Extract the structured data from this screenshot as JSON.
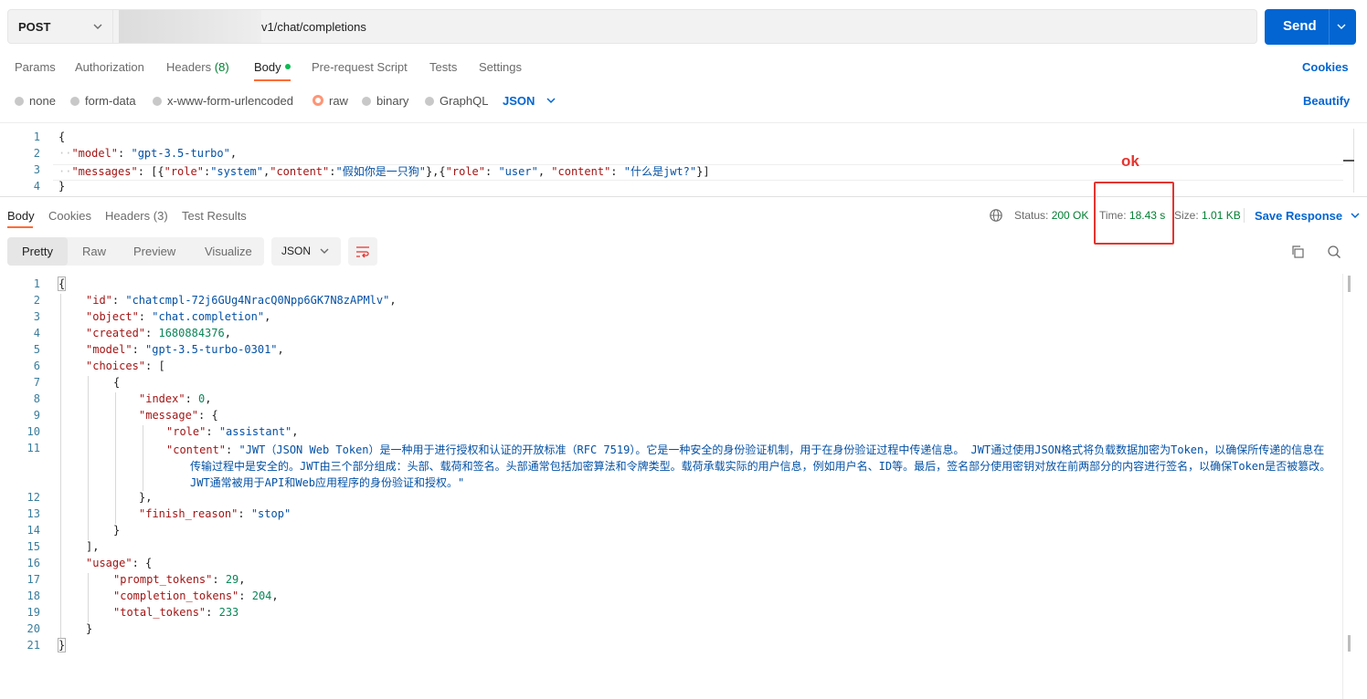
{
  "request": {
    "method": "POST",
    "url_visible": "v1/chat/completions",
    "send_label": "Send"
  },
  "request_tabs": [
    {
      "label": "Params"
    },
    {
      "label": "Authorization"
    },
    {
      "label": "Headers",
      "count": "(8)"
    },
    {
      "label": "Body",
      "active": true
    },
    {
      "label": "Pre-request Script"
    },
    {
      "label": "Tests"
    },
    {
      "label": "Settings"
    }
  ],
  "cookies_link": "Cookies",
  "body_types": [
    "none",
    "form-data",
    "x-www-form-urlencoded",
    "raw",
    "binary",
    "GraphQL"
  ],
  "body_type_selected": "raw",
  "body_format": "JSON",
  "beautify_label": "Beautify",
  "request_body": {
    "line_numbers": [
      "1",
      "2",
      "3",
      "4"
    ],
    "model_key": "\"model\"",
    "model_val": "\"gpt-3.5-turbo\"",
    "messages_key": "\"messages\"",
    "system_role": "\"system\"",
    "system_content": "\"假如你是一只狗\"",
    "user_role": "\"user\"",
    "user_content": "\"什么是jwt?\""
  },
  "response_tabs": [
    {
      "label": "Body",
      "active": true
    },
    {
      "label": "Cookies"
    },
    {
      "label": "Headers",
      "count": "(3)"
    },
    {
      "label": "Test Results"
    }
  ],
  "response_meta": {
    "status_label": "Status:",
    "status_value": "200 OK",
    "time_label": "Time:",
    "time_value": "18.43 s",
    "size_label": "Size:",
    "size_value": "1.01 KB",
    "save_response": "Save Response"
  },
  "view_modes": [
    "Pretty",
    "Raw",
    "Preview",
    "Visualize"
  ],
  "response_format": "JSON",
  "annotation": "ok",
  "response_body": {
    "id": "\"chatcmpl-72j6GUg4NracQ0Npp6GK7N8zAPMlv\"",
    "object": "\"chat.completion\"",
    "created": "1680884376",
    "model": "\"gpt-3.5-turbo-0301\"",
    "index": "0",
    "role": "\"assistant\"",
    "content_line1": "\"JWT（JSON Web Token）是一种用于进行授权和认证的开放标准（RFC 7519）。它是一种安全的身份验证机制，用于在身份验证过程中传递信息。 JWT通过使用JSON格式将负载数据加密为Token，以确保所传递的信息在",
    "content_line2": "传输过程中是安全的。JWT由三个部分组成：头部、载荷和签名。头部通常包括加密算法和令牌类型。载荷承载实际的用户信息，例如用户名、ID等。最后，签名部分使用密钥对放在前两部分的内容进行签名，以确保Token是否被篡改。",
    "content_line3": "JWT通常被用于API和Web应用程序的身份验证和授权。\"",
    "finish_reason": "\"stop\"",
    "prompt_tokens": "29",
    "completion_tokens": "204",
    "total_tokens": "233"
  }
}
